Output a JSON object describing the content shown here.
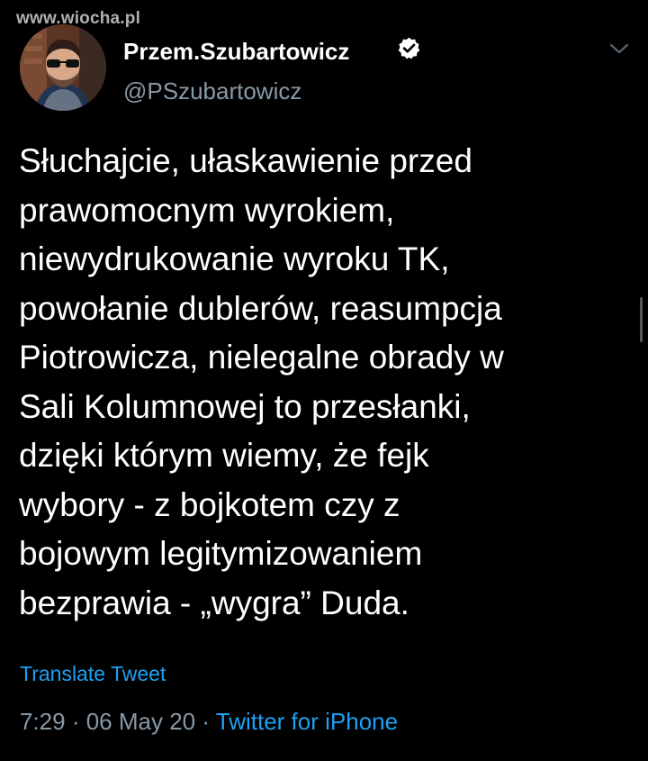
{
  "watermark": "www.wiocha.pl",
  "author": {
    "display_name": "Przem.Szubartowicz",
    "handle": "@PSzubartowicz",
    "verified": true
  },
  "tweet": {
    "lines": [
      "Słuchajcie, ułaskawienie przed",
      "prawomocnym wyrokiem,",
      "niewydrukowanie wyroku TK,",
      "powołanie dublerów, reasumpcja",
      "Piotrowicza, nielegalne obrady w",
      "Sali Kolumnowej to przesłanki,",
      "dzięki którym wiemy, że fejk",
      "wybory - z bojkotem czy z",
      "bojowym legitymizowaniem",
      "bezprawia - „wygra” Duda."
    ],
    "translate_label": "Translate Tweet",
    "time": "7:29",
    "separator": " · ",
    "date": "06 May 20",
    "source": "Twitter for iPhone"
  },
  "colors": {
    "background": "#000000",
    "text": "#ffffff",
    "muted": "#8899a6",
    "accent": "#1da1f2"
  }
}
